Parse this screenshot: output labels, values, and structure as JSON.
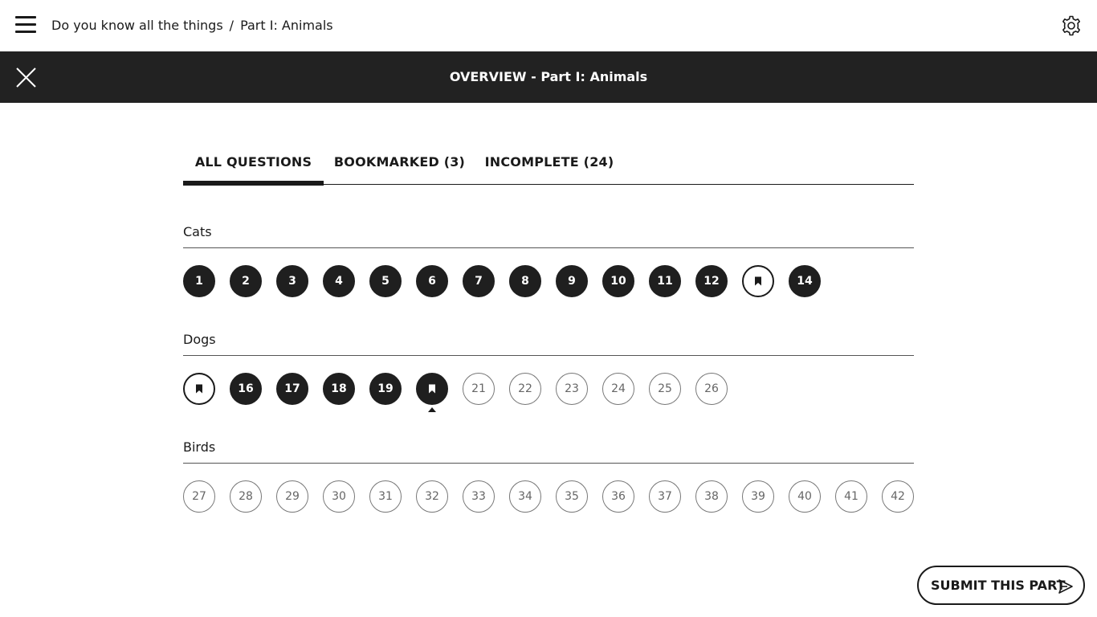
{
  "breadcrumb": {
    "course": "Do you know all the things",
    "separator": "/",
    "part": "Part I: Animals"
  },
  "overview": {
    "title": "OVERVIEW - Part I: Animals"
  },
  "tabs": [
    {
      "label": "ALL QUESTIONS",
      "active": true
    },
    {
      "label": "BOOKMARKED (3)",
      "active": false
    },
    {
      "label": "INCOMPLETE (24)",
      "active": false
    }
  ],
  "sections": [
    {
      "title": "Cats",
      "questions": [
        {
          "number": "1",
          "state": "answered"
        },
        {
          "number": "2",
          "state": "answered"
        },
        {
          "number": "3",
          "state": "answered"
        },
        {
          "number": "4",
          "state": "answered"
        },
        {
          "number": "5",
          "state": "answered"
        },
        {
          "number": "6",
          "state": "answered"
        },
        {
          "number": "7",
          "state": "answered"
        },
        {
          "number": "8",
          "state": "answered"
        },
        {
          "number": "9",
          "state": "answered"
        },
        {
          "number": "10",
          "state": "answered"
        },
        {
          "number": "11",
          "state": "answered"
        },
        {
          "number": "12",
          "state": "answered"
        },
        {
          "number": "",
          "state": "bookmarked"
        },
        {
          "number": "14",
          "state": "answered"
        }
      ]
    },
    {
      "title": "Dogs",
      "questions": [
        {
          "number": "",
          "state": "bookmarked"
        },
        {
          "number": "16",
          "state": "answered"
        },
        {
          "number": "17",
          "state": "answered"
        },
        {
          "number": "18",
          "state": "answered"
        },
        {
          "number": "19",
          "state": "answered"
        },
        {
          "number": "",
          "state": "bookmarked-answered",
          "current": true
        },
        {
          "number": "21",
          "state": "incomplete"
        },
        {
          "number": "22",
          "state": "incomplete"
        },
        {
          "number": "23",
          "state": "incomplete"
        },
        {
          "number": "24",
          "state": "incomplete"
        },
        {
          "number": "25",
          "state": "incomplete"
        },
        {
          "number": "26",
          "state": "incomplete"
        }
      ]
    },
    {
      "title": "Birds",
      "questions": [
        {
          "number": "27",
          "state": "incomplete"
        },
        {
          "number": "28",
          "state": "incomplete"
        },
        {
          "number": "29",
          "state": "incomplete"
        },
        {
          "number": "30",
          "state": "incomplete"
        },
        {
          "number": "31",
          "state": "incomplete"
        },
        {
          "number": "32",
          "state": "incomplete"
        },
        {
          "number": "33",
          "state": "incomplete"
        },
        {
          "number": "34",
          "state": "incomplete"
        },
        {
          "number": "35",
          "state": "incomplete"
        },
        {
          "number": "36",
          "state": "incomplete"
        },
        {
          "number": "37",
          "state": "incomplete"
        },
        {
          "number": "38",
          "state": "incomplete"
        },
        {
          "number": "39",
          "state": "incomplete"
        },
        {
          "number": "40",
          "state": "incomplete"
        },
        {
          "number": "41",
          "state": "incomplete"
        },
        {
          "number": "42",
          "state": "incomplete"
        }
      ]
    }
  ],
  "submit": {
    "label": "SUBMIT THIS PART",
    "icon": "send-icon"
  },
  "icons": {
    "menu": "hamburger-menu-icon",
    "settings": "gear-icon",
    "close": "close-icon",
    "bookmark": "bookmark-icon"
  },
  "colors": {
    "header_bar": "#222222",
    "answered": "#1f1f1f",
    "incomplete_border": "#777777"
  }
}
